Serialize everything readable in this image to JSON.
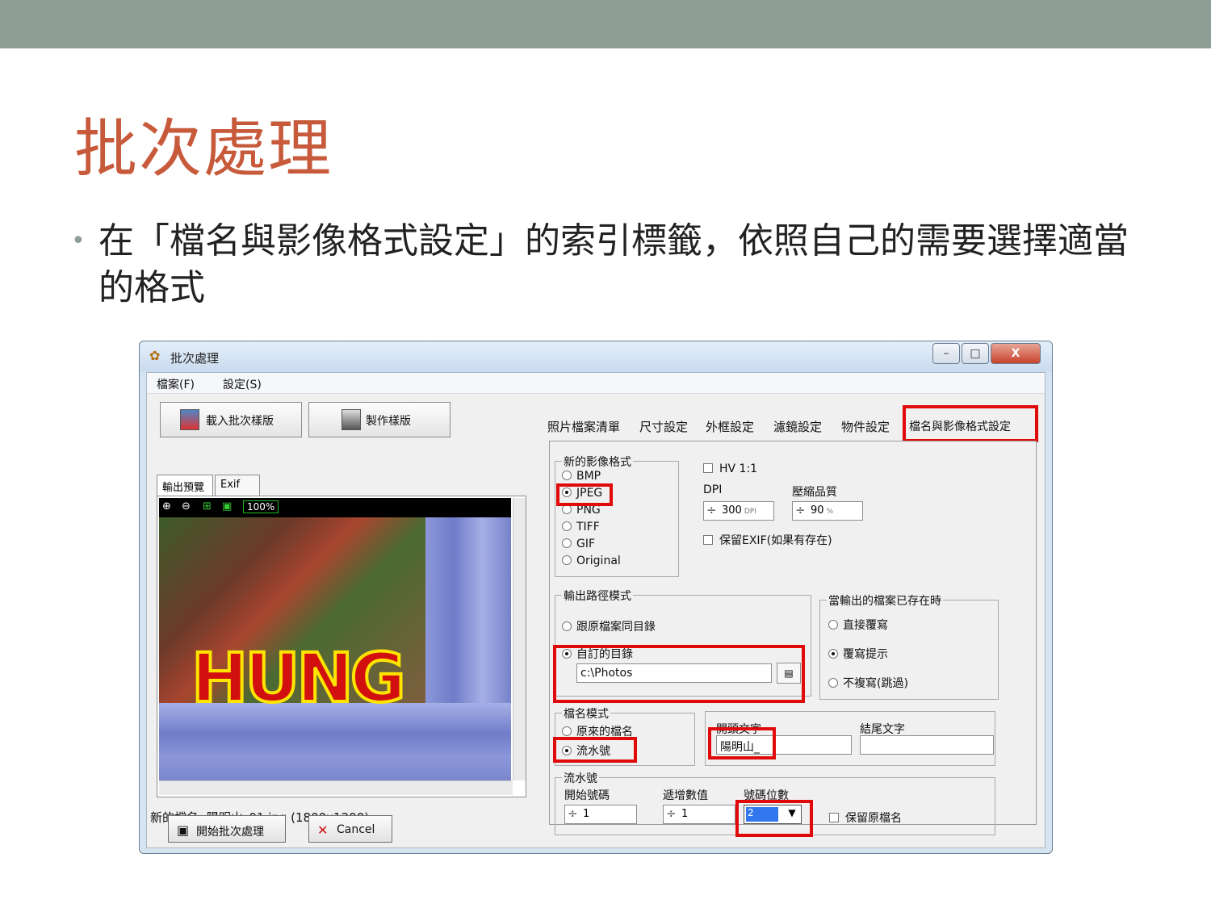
{
  "slide": {
    "title": "批次處理",
    "bullet": "在「檔名與影像格式設定」的索引標籤，依照自己的需要選擇適當的格式"
  },
  "window": {
    "title": "批次處理",
    "controls": {
      "minimize": "–",
      "maximize": "□",
      "close": "X"
    }
  },
  "menu": {
    "file": "檔案(F)",
    "settings": "設定(S)"
  },
  "left": {
    "load_button": "載入批次樣版",
    "make_button": "製作樣版",
    "tabs": [
      "輸出預覽",
      "Exif"
    ],
    "zoom": "100%",
    "preview_text": "HUNG",
    "new_filename": "新的檔名: 陽明山_01.jpg (1800x1200)"
  },
  "right": {
    "tabs": [
      "照片檔案清單",
      "尺寸設定",
      "外框設定",
      "濾鏡設定",
      "物件設定",
      "檔名與影像格式設定"
    ],
    "format_group": {
      "title": "新的影像格式",
      "options": [
        "BMP",
        "JPEG",
        "PNG",
        "TIFF",
        "GIF",
        "Original"
      ],
      "selected": "JPEG"
    },
    "hv_label": "HV 1:1",
    "dpi_label": "DPI",
    "dpi_value": "300",
    "dpi_unit": "DPI",
    "quality_label": "壓縮品質",
    "quality_value": "90",
    "quality_unit": "%",
    "keep_exif": "保留EXIF(如果有存在)",
    "path_group": {
      "title": "輸出路徑模式",
      "same_dir": "跟原檔案同目錄",
      "custom_dir": "自訂的目錄",
      "path_value": "c:\\Photos"
    },
    "exists_group": {
      "title": "當輸出的檔案已存在時",
      "overwrite": "直接覆寫",
      "prompt": "覆寫提示",
      "skip": "不複寫(跳過)"
    },
    "name_group": {
      "title": "檔名模式",
      "original": "原來的檔名",
      "serial": "流水號"
    },
    "prefix_label": "開頭文字",
    "prefix_value": "陽明山_",
    "suffix_label": "結尾文字",
    "suffix_value": "",
    "serial_group": {
      "title": "流水號",
      "start_label": "開始號碼",
      "start_value": "1",
      "step_label": "遞增數值",
      "step_value": "1",
      "digits_label": "號碼位數",
      "digits_value": "2",
      "keep_name": "保留原檔名"
    }
  },
  "bottom": {
    "start": "開始批次處理",
    "cancel": "Cancel"
  },
  "colors": {
    "accent_red": "#e00a0a",
    "title_orange": "#c75a3b",
    "topbar": "#8f9e95"
  }
}
